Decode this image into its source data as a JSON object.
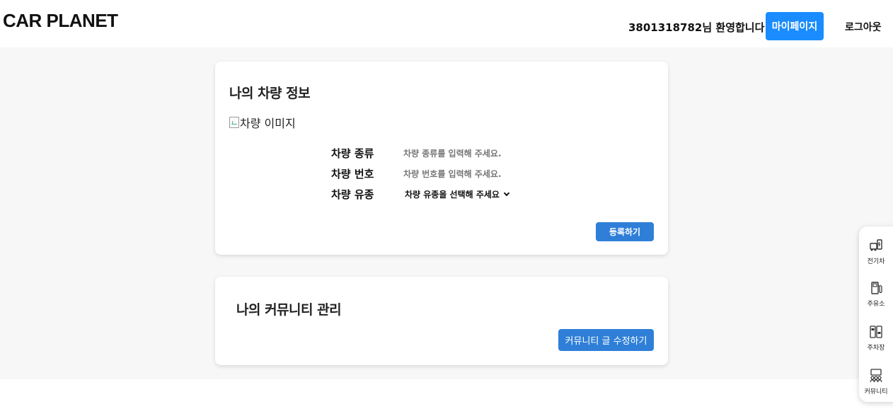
{
  "header": {
    "logo": "CAR PLANET",
    "welcome": "3801318782님 환영합니다!",
    "mypage_label": "마이페이지",
    "logout_label": "로그아웃"
  },
  "car_card": {
    "title": "나의 차량 정보",
    "image_alt": "차량 이미지",
    "rows": [
      {
        "label": "차량 종류",
        "placeholder": "차량 종류를 입력해 주세요."
      },
      {
        "label": "차량 번호",
        "placeholder": "차량 번호를 입력해 주세요."
      },
      {
        "label": "차량 유종",
        "select_value": "차량 유종을 선택해 주세요"
      }
    ],
    "register_label": "등록하기"
  },
  "community_card": {
    "title": "나의 커뮤니티 관리",
    "edit_label": "커뮤니티 글 수정하기"
  },
  "dock": {
    "items": [
      {
        "label": "전기차",
        "icon": "ev-charger-icon"
      },
      {
        "label": "주유소",
        "icon": "gas-pump-icon"
      },
      {
        "label": "주차장",
        "icon": "parking-icon"
      },
      {
        "label": "커뮤니티",
        "icon": "community-icon"
      }
    ]
  },
  "colors": {
    "primary": "#1a8cff",
    "button": "#2f7fd8",
    "background": "#f7f7f7"
  }
}
